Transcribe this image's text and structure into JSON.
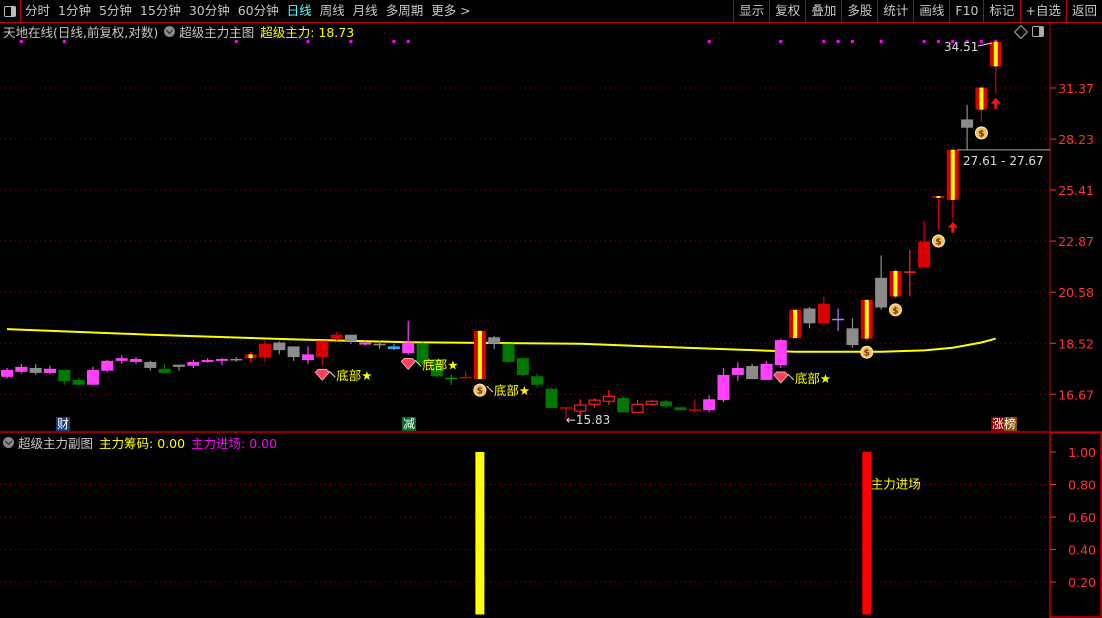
{
  "toolbar": {
    "periods": [
      "分时",
      "1分钟",
      "5分钟",
      "15分钟",
      "30分钟",
      "60分钟",
      "日线",
      "周线",
      "月线",
      "多周期",
      "更多 >"
    ],
    "active_period": "日线",
    "buttons": [
      "显示",
      "复权",
      "叠加",
      "多股",
      "统计",
      "画线",
      "F10",
      "标记",
      "+自选",
      "返回"
    ]
  },
  "main_header": {
    "stock": "天地在线(日线,前复权,对数)",
    "indicator": "超级主力主图",
    "value_label": "超级主力: 18.73"
  },
  "sub_header": {
    "indicator": "超级主力副图",
    "chips_label": "主力筹码: 0.00",
    "entry_label": "主力进场: 0.00"
  },
  "tags": {
    "cai": "财",
    "jian": "减",
    "zhangbang": "涨榜"
  },
  "colors": {
    "pink": "#ff40ff",
    "gray": "#8c8c8c",
    "green": "#007800",
    "red": "#d80000",
    "yellow": "#ffff00",
    "blue": "#33aaff",
    "purple": "#b080ff",
    "axis": "#ff3333",
    "grid": "#a00000"
  },
  "chart_data": [
    {
      "type": "candlestick",
      "scale": "log",
      "y_ticks": [
        31.37,
        28.23,
        25.41,
        22.87,
        20.58,
        18.52,
        16.67
      ],
      "y_tick_labels": [
        "31.37",
        "28.23",
        "25.41",
        "22.87",
        "20.58",
        "18.52",
        "16.67"
      ],
      "grid": true,
      "candle_fields": [
        "open",
        "close",
        "high",
        "low",
        "style"
      ],
      "candles": [
        [
          17.28,
          17.53,
          17.6,
          17.22,
          "pink"
        ],
        [
          17.46,
          17.64,
          17.75,
          17.4,
          "pink"
        ],
        [
          17.6,
          17.42,
          17.75,
          17.35,
          "gray"
        ],
        [
          17.42,
          17.57,
          17.68,
          17.38,
          "pink"
        ],
        [
          17.53,
          17.13,
          17.53,
          17.0,
          "green"
        ],
        [
          17.17,
          17.0,
          17.25,
          16.98,
          "green"
        ],
        [
          17.0,
          17.53,
          17.65,
          17.0,
          "pink"
        ],
        [
          17.5,
          17.86,
          17.9,
          17.45,
          "pink"
        ],
        [
          17.86,
          17.96,
          18.07,
          17.76,
          "pink"
        ],
        [
          17.82,
          17.93,
          18.0,
          17.75,
          "pink"
        ],
        [
          17.82,
          17.6,
          17.86,
          17.5,
          "gray"
        ],
        [
          17.57,
          17.42,
          17.75,
          17.42,
          "green"
        ],
        [
          17.72,
          17.64,
          17.72,
          17.5,
          "gray"
        ],
        [
          17.68,
          17.82,
          17.9,
          17.6,
          "pink"
        ],
        [
          17.82,
          17.89,
          17.96,
          17.79,
          "pink"
        ],
        [
          17.86,
          17.93,
          17.96,
          17.7,
          "pink"
        ],
        [
          17.93,
          17.89,
          18.0,
          17.82,
          "gray"
        ],
        [
          17.96,
          18.1,
          18.2,
          17.8,
          "red_yellow"
        ],
        [
          18.0,
          18.5,
          18.65,
          17.8,
          "red"
        ],
        [
          18.55,
          18.26,
          18.6,
          18.1,
          "gray"
        ],
        [
          18.4,
          18.0,
          18.4,
          17.86,
          "gray"
        ],
        [
          17.89,
          18.1,
          18.4,
          17.75,
          "pink"
        ],
        [
          18.0,
          18.62,
          18.62,
          17.7,
          "red"
        ],
        [
          18.7,
          18.85,
          18.95,
          18.62,
          "red"
        ],
        [
          18.85,
          18.6,
          18.85,
          18.5,
          "gray"
        ],
        [
          18.47,
          18.55,
          18.62,
          18.43,
          "pink"
        ],
        [
          18.5,
          18.45,
          18.6,
          18.3,
          "gray"
        ],
        [
          18.3,
          18.4,
          18.5,
          18.26,
          "blue"
        ],
        [
          18.15,
          18.55,
          19.4,
          18.1,
          "pink"
        ],
        [
          18.5,
          17.76,
          18.55,
          17.7,
          "green"
        ],
        [
          17.93,
          17.3,
          17.93,
          17.25,
          "green"
        ],
        [
          17.2,
          17.22,
          17.35,
          17.0,
          "green_cross"
        ],
        [
          17.25,
          17.28,
          17.5,
          17.25,
          "red"
        ],
        [
          17.2,
          19.0,
          19.0,
          17.2,
          "red_yellow"
        ],
        [
          18.75,
          18.5,
          18.8,
          18.3,
          "gray"
        ],
        [
          18.5,
          17.82,
          18.5,
          17.8,
          "green"
        ],
        [
          17.96,
          17.35,
          17.96,
          17.3,
          "green"
        ],
        [
          17.3,
          17.0,
          17.4,
          16.9,
          "green"
        ],
        [
          16.86,
          16.2,
          16.9,
          16.2,
          "green"
        ],
        [
          16.2,
          16.23,
          16.25,
          15.83,
          "red"
        ],
        [
          16.1,
          16.3,
          16.5,
          15.95,
          "red_hollow"
        ],
        [
          16.33,
          16.47,
          16.54,
          16.2,
          "red_hollow"
        ],
        [
          16.43,
          16.6,
          16.82,
          16.3,
          "red_hollow"
        ],
        [
          16.54,
          16.06,
          16.6,
          16.06,
          "green"
        ],
        [
          16.06,
          16.33,
          16.47,
          16.06,
          "red_hollow"
        ],
        [
          16.33,
          16.43,
          16.47,
          16.3,
          "red_hollow"
        ],
        [
          16.43,
          16.26,
          16.47,
          16.2,
          "green"
        ],
        [
          16.23,
          16.13,
          16.23,
          16.13,
          "green"
        ],
        [
          16.13,
          16.16,
          16.5,
          16.13,
          "red"
        ],
        [
          16.13,
          16.5,
          16.64,
          16.06,
          "pink"
        ],
        [
          16.47,
          17.35,
          17.6,
          16.4,
          "pink"
        ],
        [
          17.35,
          17.6,
          17.8,
          17.14,
          "pink"
        ],
        [
          17.67,
          17.2,
          17.75,
          17.2,
          "gray"
        ],
        [
          17.17,
          17.75,
          17.86,
          17.17,
          "pink"
        ],
        [
          17.7,
          18.64,
          18.7,
          17.6,
          "pink"
        ],
        [
          18.72,
          19.84,
          19.9,
          18.72,
          "red_yellow"
        ],
        [
          19.9,
          19.3,
          19.96,
          19.1,
          "gray"
        ],
        [
          19.3,
          20.1,
          20.4,
          19.2,
          "red"
        ],
        [
          19.45,
          19.45,
          19.9,
          19.0,
          "purple_cross"
        ],
        [
          19.1,
          18.45,
          19.5,
          18.35,
          "gray"
        ],
        [
          18.7,
          20.25,
          20.3,
          18.6,
          "red_yellow"
        ],
        [
          19.94,
          21.2,
          22.2,
          19.85,
          "gray"
        ],
        [
          20.4,
          21.5,
          21.6,
          20.3,
          "red_yellow"
        ],
        [
          21.45,
          21.45,
          22.46,
          20.4,
          "red_cross"
        ],
        [
          21.65,
          22.85,
          23.85,
          21.65,
          "red"
        ],
        [
          25.0,
          25.1,
          25.1,
          23.4,
          "red_yellow"
        ],
        [
          24.9,
          27.61,
          27.67,
          24.0,
          "red_yellow"
        ],
        [
          28.9,
          29.4,
          30.3,
          27.61,
          "gray"
        ],
        [
          30.0,
          31.4,
          31.4,
          29.25,
          "red_yellow"
        ],
        [
          32.8,
          34.51,
          34.51,
          31.0,
          "red_yellow"
        ]
      ],
      "ma_line": [
        [
          0,
          19.07
        ],
        [
          10,
          18.85
        ],
        [
          20,
          18.67
        ],
        [
          28,
          18.56
        ],
        [
          40,
          18.5
        ],
        [
          50,
          18.3
        ],
        [
          55,
          18.2
        ],
        [
          61,
          18.2
        ],
        [
          64,
          18.25
        ],
        [
          66,
          18.35
        ],
        [
          68,
          18.55
        ],
        [
          69,
          18.7
        ]
      ],
      "top_dots": [
        1,
        4,
        16,
        21,
        24,
        27,
        28,
        49,
        54,
        57,
        58,
        59,
        61,
        64,
        65,
        66,
        67,
        68,
        69
      ],
      "markers": [
        {
          "index": 22,
          "type": "gem",
          "label": "底部★"
        },
        {
          "index": 28,
          "type": "gem",
          "label": "底部★"
        },
        {
          "index": 54,
          "type": "gem",
          "label": "底部★"
        },
        {
          "index": 33,
          "type": "moneybag",
          "label": "底部★"
        },
        {
          "index": 60,
          "type": "moneybag",
          "label": ""
        },
        {
          "index": 62,
          "type": "moneybag",
          "label": ""
        },
        {
          "index": 65,
          "type": "moneybag",
          "label": ""
        },
        {
          "index": 68,
          "type": "moneybag",
          "label": ""
        },
        {
          "index": 66,
          "type": "arrow-up",
          "label": ""
        },
        {
          "index": 69,
          "type": "arrow-up",
          "label": ""
        }
      ],
      "annotations": {
        "high": "34.51",
        "low": "15.83",
        "range": "27.61 - 27.67",
        "range_price": 27.61
      }
    },
    {
      "type": "bar",
      "y_ticks": [
        1.0,
        0.8,
        0.6,
        0.4,
        0.2
      ],
      "y_tick_labels": [
        "1.00",
        "0.80",
        "0.60",
        "0.40",
        "0.20"
      ],
      "ylim": [
        0,
        1.0
      ],
      "bars": [
        {
          "index": 33,
          "value": 1.0,
          "color": "yellow"
        },
        {
          "index": 60,
          "value": 1.0,
          "color": "red",
          "label": "主力进场"
        }
      ]
    }
  ]
}
